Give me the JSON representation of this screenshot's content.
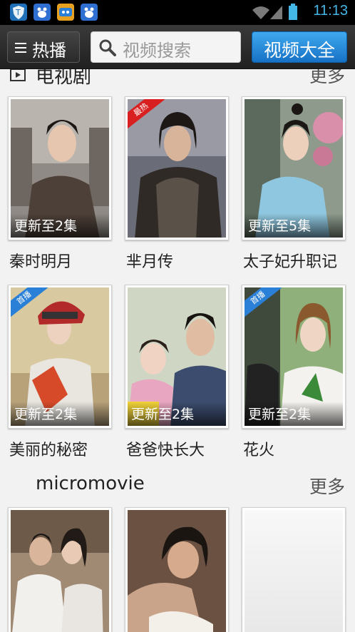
{
  "statusbar": {
    "time": "11:13",
    "icons": [
      "shield-app-icon",
      "baidu-app-icon",
      "game-app-icon",
      "baidu-app-icon",
      "wifi-icon",
      "signal-icon",
      "battery-icon"
    ]
  },
  "toolbar": {
    "menu_label": "热播",
    "search_placeholder": "视频搜索",
    "all_videos_label": "视频大全"
  },
  "sections": [
    {
      "title": "电视剧",
      "more": "更多",
      "items": [
        {
          "title": "秦时明月",
          "update": "更新至2集",
          "badge": ""
        },
        {
          "title": "芈月传",
          "update": "",
          "badge": "最热"
        },
        {
          "title": "太子妃升职记",
          "update": "更新至5集",
          "badge": ""
        },
        {
          "title": "美丽的秘密",
          "update": "更新至2集",
          "badge": "首播"
        },
        {
          "title": "爸爸快长大",
          "update": "更新至2集",
          "badge": ""
        },
        {
          "title": "花火",
          "update": "更新至2集",
          "badge": "首播"
        }
      ]
    },
    {
      "title": "micromovie",
      "more": "更多",
      "items": [
        {
          "title": "",
          "update": "",
          "badge": ""
        },
        {
          "title": "",
          "update": "",
          "badge": ""
        },
        {
          "title": "",
          "update": "",
          "badge": ""
        }
      ]
    }
  ],
  "colors": {
    "accent": "#1f86da",
    "time": "#45b7e6",
    "badge_hot": "#d82020",
    "badge_premiere": "#2a7fd6"
  }
}
